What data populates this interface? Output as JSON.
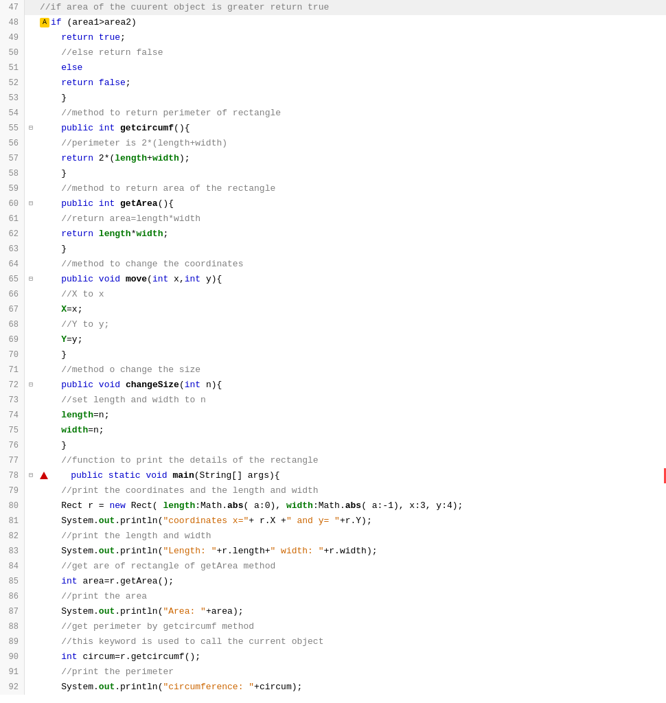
{
  "lines": [
    {
      "num": 47,
      "fold": "",
      "content": [
        {
          "t": "comment",
          "v": "//if area of the cuurent object is greater return true"
        }
      ],
      "hasRightBorder": false
    },
    {
      "num": 48,
      "fold": "",
      "content": [
        {
          "t": "warning",
          "v": ""
        },
        {
          "t": "kw",
          "v": "if"
        },
        {
          "t": "normal",
          "v": " (area1>area2)"
        }
      ],
      "hasRightBorder": false
    },
    {
      "num": 49,
      "fold": "",
      "content": [
        {
          "t": "normal",
          "v": "    "
        },
        {
          "t": "kw",
          "v": "return"
        },
        {
          "t": "normal",
          "v": " "
        },
        {
          "t": "kw",
          "v": "true"
        },
        {
          "t": "normal",
          "v": ";"
        }
      ],
      "hasRightBorder": false
    },
    {
      "num": 50,
      "fold": "",
      "content": [
        {
          "t": "comment",
          "v": "    //else return false"
        }
      ],
      "hasRightBorder": false
    },
    {
      "num": 51,
      "fold": "",
      "content": [
        {
          "t": "normal",
          "v": "    "
        },
        {
          "t": "kw",
          "v": "else"
        }
      ],
      "hasRightBorder": false
    },
    {
      "num": 52,
      "fold": "",
      "content": [
        {
          "t": "normal",
          "v": "    "
        },
        {
          "t": "kw",
          "v": "return"
        },
        {
          "t": "normal",
          "v": " "
        },
        {
          "t": "kw",
          "v": "false"
        },
        {
          "t": "normal",
          "v": ";"
        }
      ],
      "hasRightBorder": false
    },
    {
      "num": 53,
      "fold": "",
      "content": [
        {
          "t": "normal",
          "v": "    }"
        }
      ],
      "hasRightBorder": false
    },
    {
      "num": 54,
      "fold": "",
      "content": [
        {
          "t": "comment",
          "v": "    //method to return perimeter of rectangle"
        }
      ],
      "hasRightBorder": false
    },
    {
      "num": 55,
      "fold": "⊟",
      "content": [
        {
          "t": "normal",
          "v": "    "
        },
        {
          "t": "kw",
          "v": "public"
        },
        {
          "t": "normal",
          "v": " "
        },
        {
          "t": "kw",
          "v": "int"
        },
        {
          "t": "normal",
          "v": " "
        },
        {
          "t": "method",
          "v": "getcircumf"
        },
        {
          "t": "normal",
          "v": "(){"
        }
      ],
      "hasRightBorder": false
    },
    {
      "num": 56,
      "fold": "",
      "content": [
        {
          "t": "comment",
          "v": "    //perimeter is 2*(length+width)"
        }
      ],
      "hasRightBorder": false
    },
    {
      "num": 57,
      "fold": "",
      "content": [
        {
          "t": "normal",
          "v": "    "
        },
        {
          "t": "kw",
          "v": "return"
        },
        {
          "t": "normal",
          "v": " 2*("
        },
        {
          "t": "var-green",
          "v": "length"
        },
        {
          "t": "normal",
          "v": "+"
        },
        {
          "t": "var-green",
          "v": "width"
        },
        {
          "t": "normal",
          "v": ");"
        }
      ],
      "hasRightBorder": false
    },
    {
      "num": 58,
      "fold": "",
      "content": [
        {
          "t": "normal",
          "v": "    }"
        }
      ],
      "hasRightBorder": false
    },
    {
      "num": 59,
      "fold": "",
      "content": [
        {
          "t": "comment",
          "v": "    //method to return area of the rectangle"
        }
      ],
      "hasRightBorder": false
    },
    {
      "num": 60,
      "fold": "⊟",
      "content": [
        {
          "t": "normal",
          "v": "    "
        },
        {
          "t": "kw",
          "v": "public"
        },
        {
          "t": "normal",
          "v": " "
        },
        {
          "t": "kw",
          "v": "int"
        },
        {
          "t": "normal",
          "v": " "
        },
        {
          "t": "method",
          "v": "getArea"
        },
        {
          "t": "normal",
          "v": "(){"
        }
      ],
      "hasRightBorder": false
    },
    {
      "num": 61,
      "fold": "",
      "content": [
        {
          "t": "comment",
          "v": "    //return area=length*width"
        }
      ],
      "hasRightBorder": false
    },
    {
      "num": 62,
      "fold": "",
      "content": [
        {
          "t": "normal",
          "v": "    "
        },
        {
          "t": "kw",
          "v": "return"
        },
        {
          "t": "normal",
          "v": " "
        },
        {
          "t": "var-green",
          "v": "length"
        },
        {
          "t": "normal",
          "v": "*"
        },
        {
          "t": "var-green",
          "v": "width"
        },
        {
          "t": "normal",
          "v": ";"
        }
      ],
      "hasRightBorder": false
    },
    {
      "num": 63,
      "fold": "",
      "content": [
        {
          "t": "normal",
          "v": "    }"
        }
      ],
      "hasRightBorder": false
    },
    {
      "num": 64,
      "fold": "",
      "content": [
        {
          "t": "comment",
          "v": "    //method to change the coordinates"
        }
      ],
      "hasRightBorder": false
    },
    {
      "num": 65,
      "fold": "⊟",
      "content": [
        {
          "t": "normal",
          "v": "    "
        },
        {
          "t": "kw",
          "v": "public"
        },
        {
          "t": "normal",
          "v": " "
        },
        {
          "t": "kw",
          "v": "void"
        },
        {
          "t": "normal",
          "v": " "
        },
        {
          "t": "method",
          "v": "move"
        },
        {
          "t": "normal",
          "v": "("
        },
        {
          "t": "kw",
          "v": "int"
        },
        {
          "t": "normal",
          "v": " x,"
        },
        {
          "t": "kw",
          "v": "int"
        },
        {
          "t": "normal",
          "v": " y){"
        }
      ],
      "hasRightBorder": false
    },
    {
      "num": 66,
      "fold": "",
      "content": [
        {
          "t": "comment",
          "v": "    //X to x"
        }
      ],
      "hasRightBorder": false
    },
    {
      "num": 67,
      "fold": "",
      "content": [
        {
          "t": "normal",
          "v": "    "
        },
        {
          "t": "var-green",
          "v": "X"
        },
        {
          "t": "normal",
          "v": "=x;"
        }
      ],
      "hasRightBorder": false
    },
    {
      "num": 68,
      "fold": "",
      "content": [
        {
          "t": "comment",
          "v": "    //Y to y;"
        }
      ],
      "hasRightBorder": false
    },
    {
      "num": 69,
      "fold": "",
      "content": [
        {
          "t": "normal",
          "v": "    "
        },
        {
          "t": "var-green",
          "v": "Y"
        },
        {
          "t": "normal",
          "v": "=y;"
        }
      ],
      "hasRightBorder": false
    },
    {
      "num": 70,
      "fold": "",
      "content": [
        {
          "t": "normal",
          "v": "    }"
        }
      ],
      "hasRightBorder": false
    },
    {
      "num": 71,
      "fold": "",
      "content": [
        {
          "t": "comment",
          "v": "    //method o change the size"
        }
      ],
      "hasRightBorder": false
    },
    {
      "num": 72,
      "fold": "⊟",
      "content": [
        {
          "t": "normal",
          "v": "    "
        },
        {
          "t": "kw",
          "v": "public"
        },
        {
          "t": "normal",
          "v": " "
        },
        {
          "t": "kw",
          "v": "void"
        },
        {
          "t": "normal",
          "v": " "
        },
        {
          "t": "method",
          "v": "changeSize"
        },
        {
          "t": "normal",
          "v": "("
        },
        {
          "t": "kw",
          "v": "int"
        },
        {
          "t": "normal",
          "v": " n){"
        }
      ],
      "hasRightBorder": false
    },
    {
      "num": 73,
      "fold": "",
      "content": [
        {
          "t": "comment",
          "v": "    //set length and width to n"
        }
      ],
      "hasRightBorder": false
    },
    {
      "num": 74,
      "fold": "",
      "content": [
        {
          "t": "normal",
          "v": "    "
        },
        {
          "t": "var-green",
          "v": "length"
        },
        {
          "t": "normal",
          "v": "=n;"
        }
      ],
      "hasRightBorder": false
    },
    {
      "num": 75,
      "fold": "",
      "content": [
        {
          "t": "normal",
          "v": "    "
        },
        {
          "t": "var-green",
          "v": "width"
        },
        {
          "t": "normal",
          "v": "=n;"
        }
      ],
      "hasRightBorder": false
    },
    {
      "num": 76,
      "fold": "",
      "content": [
        {
          "t": "normal",
          "v": "    }"
        }
      ],
      "hasRightBorder": false
    },
    {
      "num": 77,
      "fold": "",
      "content": [
        {
          "t": "comment",
          "v": "    //function to print the details of the rectangle"
        }
      ],
      "hasRightBorder": false
    },
    {
      "num": 78,
      "fold": "⊟",
      "content": [
        {
          "t": "error-tri",
          "v": ""
        },
        {
          "t": "normal",
          "v": "    "
        },
        {
          "t": "kw",
          "v": "public"
        },
        {
          "t": "normal",
          "v": " "
        },
        {
          "t": "kw",
          "v": "static"
        },
        {
          "t": "normal",
          "v": " "
        },
        {
          "t": "kw",
          "v": "void"
        },
        {
          "t": "normal",
          "v": " "
        },
        {
          "t": "method",
          "v": "main"
        },
        {
          "t": "normal",
          "v": "(String[] args){"
        }
      ],
      "hasRightBorder": true
    },
    {
      "num": 79,
      "fold": "",
      "content": [
        {
          "t": "comment",
          "v": "    //print the coordinates and the length and width"
        }
      ],
      "hasRightBorder": false
    },
    {
      "num": 80,
      "fold": "",
      "content": [
        {
          "t": "normal",
          "v": "    Rect r = "
        },
        {
          "t": "kw",
          "v": "new"
        },
        {
          "t": "normal",
          "v": " Rect( "
        },
        {
          "t": "var-green",
          "v": "length"
        },
        {
          "t": "normal",
          "v": ":Math."
        },
        {
          "t": "method",
          "v": "abs"
        },
        {
          "t": "normal",
          "v": "( a:0), "
        },
        {
          "t": "var-green",
          "v": "width"
        },
        {
          "t": "normal",
          "v": ":Math."
        },
        {
          "t": "method",
          "v": "abs"
        },
        {
          "t": "normal",
          "v": "( a:-1), x:3, y:4);"
        }
      ],
      "hasRightBorder": false
    },
    {
      "num": 81,
      "fold": "",
      "content": [
        {
          "t": "normal",
          "v": "    System."
        },
        {
          "t": "var-green",
          "v": "out"
        },
        {
          "t": "normal",
          "v": ".println("
        },
        {
          "t": "string",
          "v": "\"coordinates x=\""
        },
        {
          "t": "normal",
          "v": "+ r.X +"
        },
        {
          "t": "string",
          "v": "\" and y= \""
        },
        {
          "t": "normal",
          "v": "+r.Y);"
        }
      ],
      "hasRightBorder": false
    },
    {
      "num": 82,
      "fold": "",
      "content": [
        {
          "t": "comment",
          "v": "    //print the length and width"
        }
      ],
      "hasRightBorder": false
    },
    {
      "num": 83,
      "fold": "",
      "content": [
        {
          "t": "normal",
          "v": "    System."
        },
        {
          "t": "var-green",
          "v": "out"
        },
        {
          "t": "normal",
          "v": ".println("
        },
        {
          "t": "string",
          "v": "\"Length: \""
        },
        {
          "t": "normal",
          "v": "+r.length+"
        },
        {
          "t": "string",
          "v": "\" width: \""
        },
        {
          "t": "normal",
          "v": "+r.width);"
        }
      ],
      "hasRightBorder": false
    },
    {
      "num": 84,
      "fold": "",
      "content": [
        {
          "t": "comment",
          "v": "    //get are of rectangle of getArea method"
        }
      ],
      "hasRightBorder": false
    },
    {
      "num": 85,
      "fold": "",
      "content": [
        {
          "t": "normal",
          "v": "    "
        },
        {
          "t": "kw",
          "v": "int"
        },
        {
          "t": "normal",
          "v": " area=r.getArea();"
        }
      ],
      "hasRightBorder": false
    },
    {
      "num": 86,
      "fold": "",
      "content": [
        {
          "t": "comment",
          "v": "    //print the area"
        }
      ],
      "hasRightBorder": false
    },
    {
      "num": 87,
      "fold": "",
      "content": [
        {
          "t": "normal",
          "v": "    System."
        },
        {
          "t": "var-green",
          "v": "out"
        },
        {
          "t": "normal",
          "v": ".println("
        },
        {
          "t": "string",
          "v": "\"Area: \""
        },
        {
          "t": "normal",
          "v": "+area);"
        }
      ],
      "hasRightBorder": false
    },
    {
      "num": 88,
      "fold": "",
      "content": [
        {
          "t": "comment",
          "v": "    //get perimeter by getcircumf method"
        }
      ],
      "hasRightBorder": false
    },
    {
      "num": 89,
      "fold": "",
      "content": [
        {
          "t": "comment",
          "v": "    //this keyword is used to call the current object"
        }
      ],
      "hasRightBorder": false
    },
    {
      "num": 90,
      "fold": "",
      "content": [
        {
          "t": "normal",
          "v": "    "
        },
        {
          "t": "kw",
          "v": "int"
        },
        {
          "t": "normal",
          "v": " circum=r.getcircumf();"
        }
      ],
      "hasRightBorder": false
    },
    {
      "num": 91,
      "fold": "",
      "content": [
        {
          "t": "comment",
          "v": "    //print the perimeter"
        }
      ],
      "hasRightBorder": false
    },
    {
      "num": 92,
      "fold": "",
      "content": [
        {
          "t": "normal",
          "v": "    System."
        },
        {
          "t": "var-green",
          "v": "out"
        },
        {
          "t": "normal",
          "v": ".println("
        },
        {
          "t": "string",
          "v": "\"circumference: \""
        },
        {
          "t": "normal",
          "v": "+circum);"
        }
      ],
      "hasRightBorder": false
    }
  ]
}
